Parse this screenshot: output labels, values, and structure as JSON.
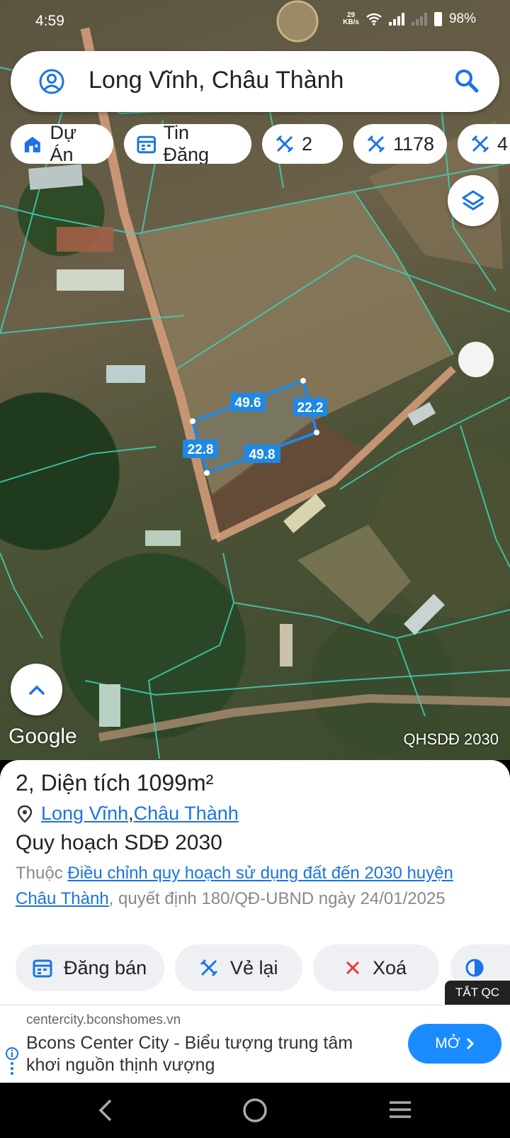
{
  "status_bar": {
    "time": "4:59",
    "speed_value": "29",
    "speed_unit": "KB/s",
    "battery": "98%"
  },
  "search": {
    "location_title": "Long Vĩnh, Châu Thành"
  },
  "chips": [
    {
      "label": "Dự Án",
      "icon": "building-icon"
    },
    {
      "label": "Tin Đăng",
      "icon": "calendar-icon"
    },
    {
      "label": "2",
      "icon": "measure-icon"
    },
    {
      "label": "1178",
      "icon": "measure-icon"
    },
    {
      "label": "4",
      "icon": "measure-icon"
    }
  ],
  "map": {
    "plot_edges": {
      "top": "49.6",
      "right": "22.2",
      "bottom": "49.8",
      "left": "22.8"
    },
    "google_label": "Google",
    "layer_tag": "QHSDĐ 2030",
    "colors": {
      "parcel_lines": "#3fd1b6",
      "plot_outline": "#1e88e5",
      "road": "#d9a07c"
    }
  },
  "info": {
    "heading": "2, Diện tích 1099m²",
    "location_parts": [
      "Long Vĩnh",
      ", ",
      "Châu Thành"
    ],
    "plan_title": "Quy hoạch SDĐ 2030",
    "desc_prefix": "Thuộc ",
    "desc_link": "Điều chỉnh quy hoạch sử dụng đất đến 2030 huyện Châu Thành",
    "desc_suffix": ", quyết định 180/QĐ-UBND ngày 24/01/2025"
  },
  "actions": [
    {
      "label": "Đăng bán",
      "icon": "calendar-icon"
    },
    {
      "label": "Vẻ lại",
      "icon": "measure-icon"
    },
    {
      "label": "Xoá",
      "icon": "close-icon"
    }
  ],
  "ad": {
    "close_label": "TẮT QC",
    "domain": "centercity.bconshomes.vn",
    "text": "Bcons Center City - Biểu tượng trung tâm khơi nguồn thịnh vượng",
    "button": "MỞ"
  }
}
